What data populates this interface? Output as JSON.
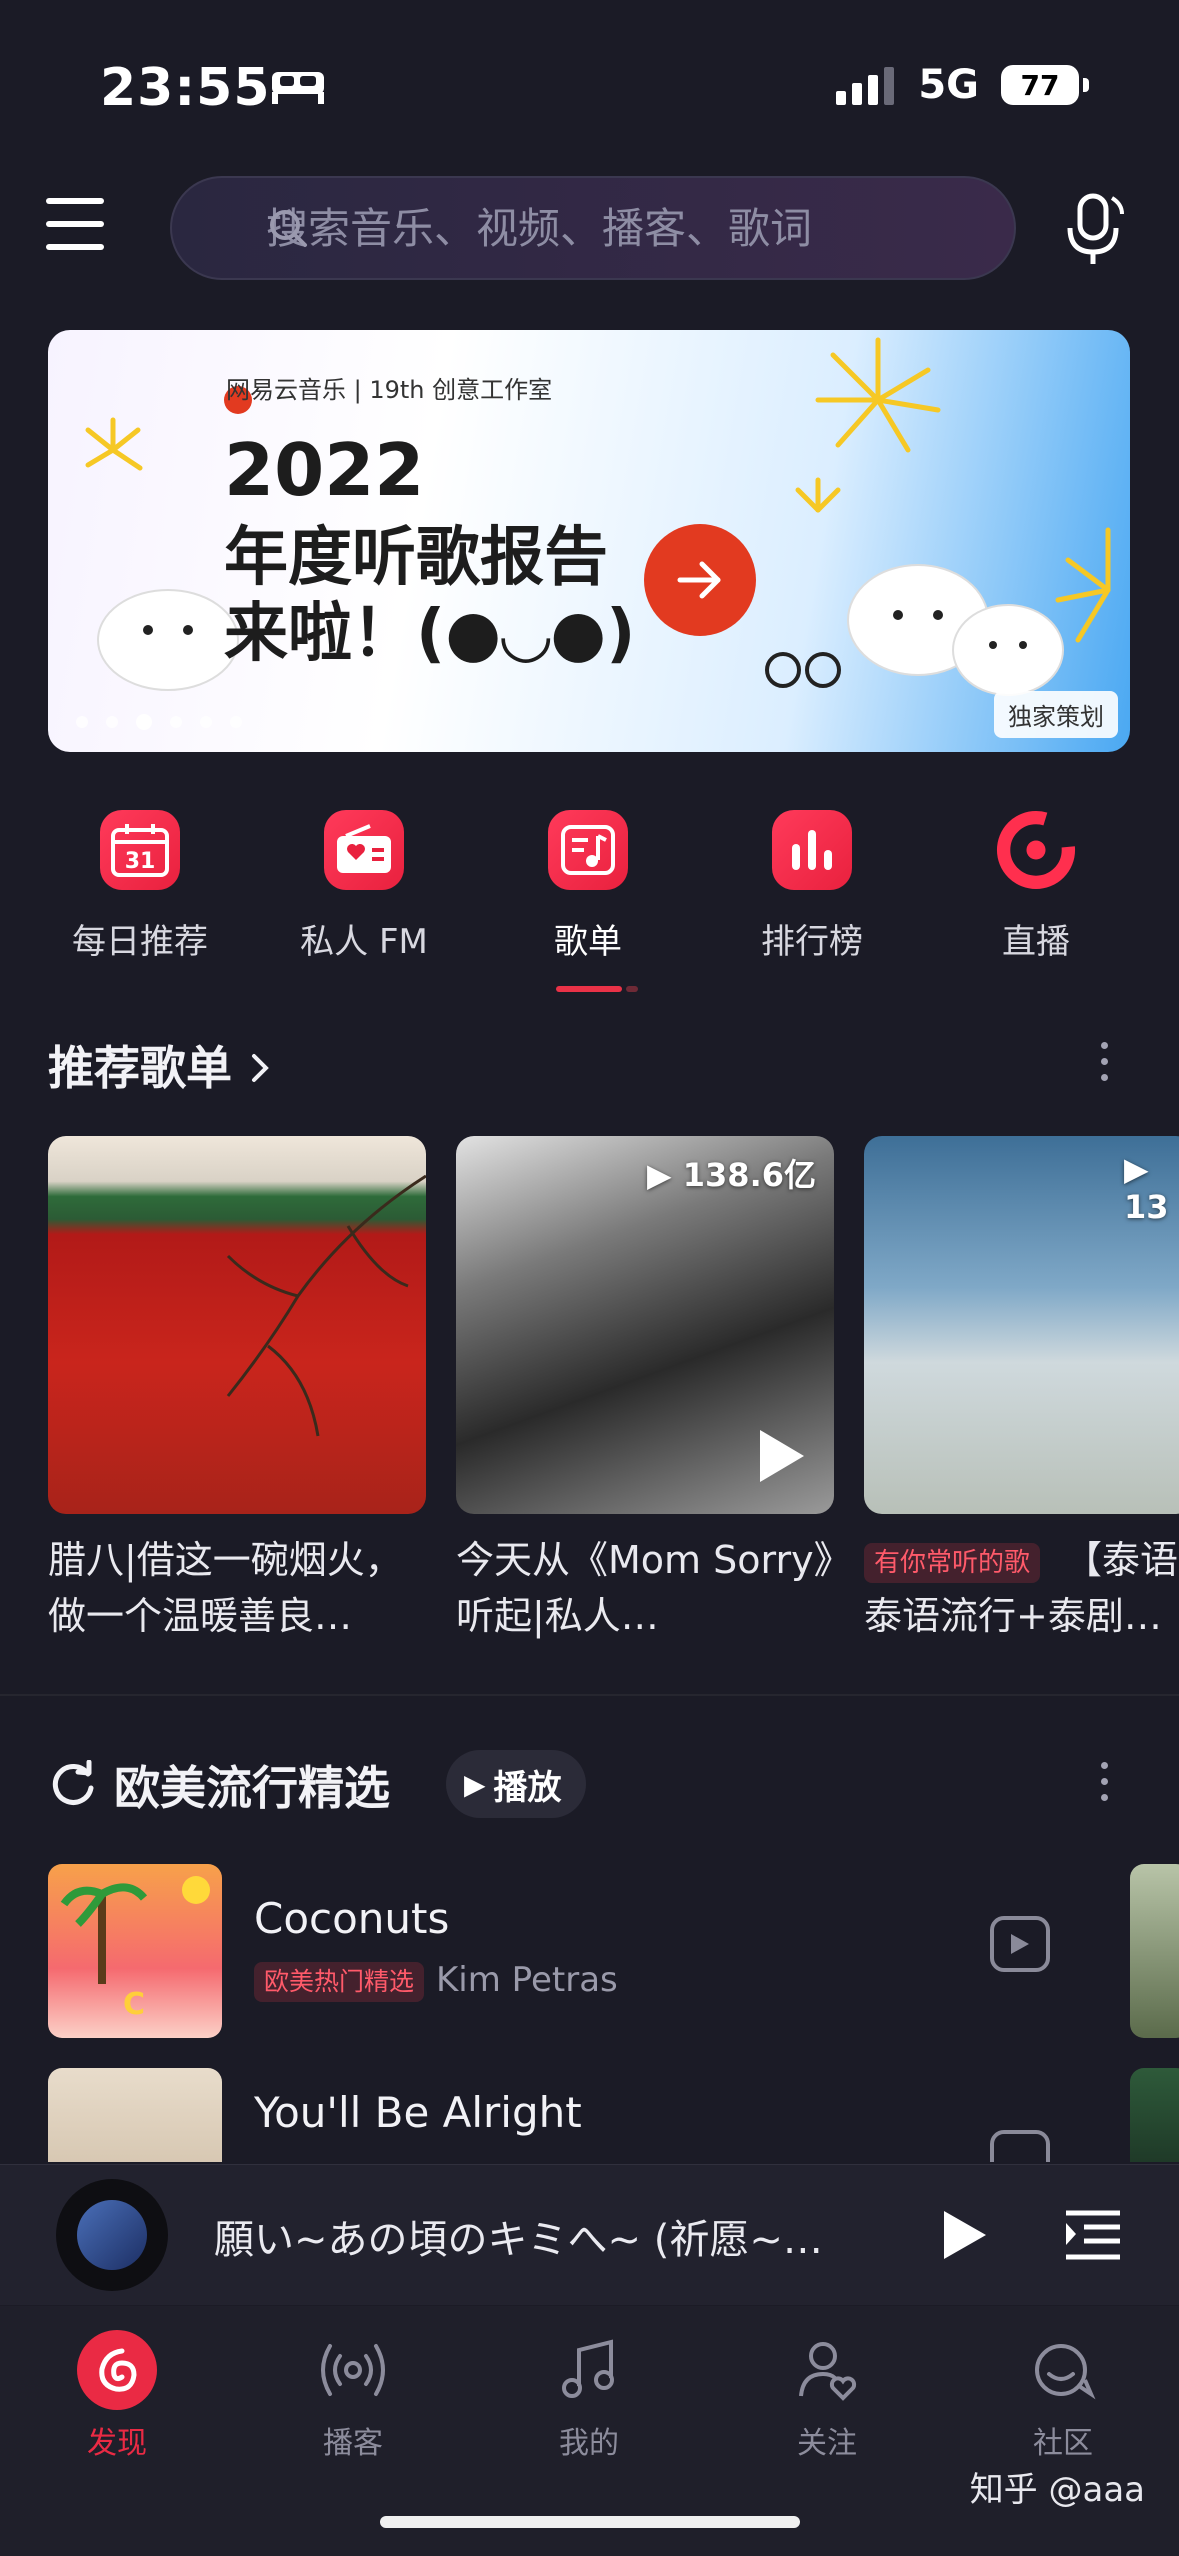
{
  "status": {
    "time": "23:55",
    "network": "5G",
    "battery": "77"
  },
  "search": {
    "placeholder": "搜索音乐、视频、播客、歌词"
  },
  "banner": {
    "brand": "网易云音乐 | 19th 创意工作室",
    "year": "2022",
    "line2": "年度听歌报告",
    "line3": "来啦！(●◡●)",
    "tag": "独家策划",
    "slide_index": 3,
    "slide_count": 6
  },
  "quick_nav": [
    {
      "label": "每日推荐",
      "icon": "calendar-icon",
      "badge": "31"
    },
    {
      "label": "私人 FM",
      "icon": "radio-icon"
    },
    {
      "label": "歌单",
      "icon": "playlist-icon"
    },
    {
      "label": "排行榜",
      "icon": "chart-icon"
    },
    {
      "label": "直播",
      "icon": "live-icon"
    }
  ],
  "recommend": {
    "title": "推荐歌单",
    "cards": [
      {
        "title": "腊八|借这一碗烟火，做一个温暖善良…",
        "play_count": ""
      },
      {
        "title": "今天从《Mom Sorry》听起|私人…",
        "play_count": "138.6亿"
      },
      {
        "tag": "有你常听的歌",
        "title_tail": "【泰语",
        "title_line2": "泰语流行+泰剧…",
        "play_count": "13"
      }
    ]
  },
  "western": {
    "title": "欧美流行精选",
    "play_label": "播放",
    "songs": [
      {
        "name": "Coconuts",
        "tag": "欧美热门精选",
        "artist": "Kim Petras"
      },
      {
        "name": "You'll Be Alright",
        "tag": "",
        "artist": ""
      }
    ]
  },
  "player": {
    "title": "願い~あの頃のキミへ~ (祈愿~…"
  },
  "tabs": [
    {
      "label": "发现",
      "icon": "netease-logo-icon",
      "active": true
    },
    {
      "label": "播客",
      "icon": "podcast-icon"
    },
    {
      "label": "我的",
      "icon": "music-note-icon"
    },
    {
      "label": "关注",
      "icon": "follow-icon"
    },
    {
      "label": "社区",
      "icon": "community-icon"
    }
  ],
  "watermark": "知乎 @aaa",
  "colors": {
    "accent": "#ea2a44",
    "background": "#1b1b26"
  }
}
